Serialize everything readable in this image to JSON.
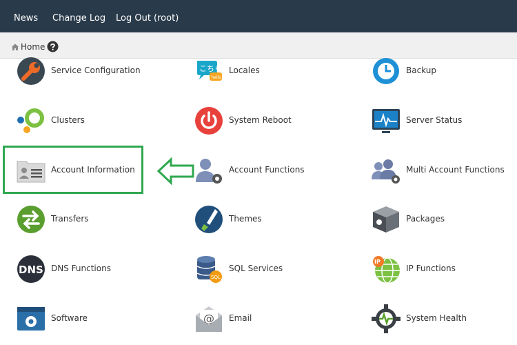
{
  "topnav": {
    "news": "News",
    "changelog": "Change Log",
    "logout": "Log Out (root)"
  },
  "breadcrumb": {
    "home": "Home"
  },
  "items": [
    {
      "label": "Service Configuration",
      "icon": "wrench-icon"
    },
    {
      "label": "Locales",
      "icon": "speech-bubble-icon"
    },
    {
      "label": "Backup",
      "icon": "clock-icon"
    },
    {
      "label": "Clusters",
      "icon": "circles-icon"
    },
    {
      "label": "System Reboot",
      "icon": "power-icon"
    },
    {
      "label": "Server Status",
      "icon": "monitor-icon"
    },
    {
      "label": "Account Information",
      "icon": "id-card-icon"
    },
    {
      "label": "Account Functions",
      "icon": "user-gear-icon"
    },
    {
      "label": "Multi Account Functions",
      "icon": "users-gear-icon"
    },
    {
      "label": "Transfers",
      "icon": "transfer-arrows-icon"
    },
    {
      "label": "Themes",
      "icon": "paintbrush-icon"
    },
    {
      "label": "Packages",
      "icon": "package-box-icon"
    },
    {
      "label": "DNS Functions",
      "icon": "dns-icon"
    },
    {
      "label": "SQL Services",
      "icon": "database-icon"
    },
    {
      "label": "IP Functions",
      "icon": "ip-globe-icon"
    },
    {
      "label": "Software",
      "icon": "software-window-icon"
    },
    {
      "label": "Email",
      "icon": "envelope-icon"
    },
    {
      "label": "System Health",
      "icon": "health-gear-icon"
    }
  ],
  "colors": {
    "topbar": "#293a4a",
    "highlight": "#2fa84f",
    "breadcrumb_bg": "#f0f0f0"
  }
}
